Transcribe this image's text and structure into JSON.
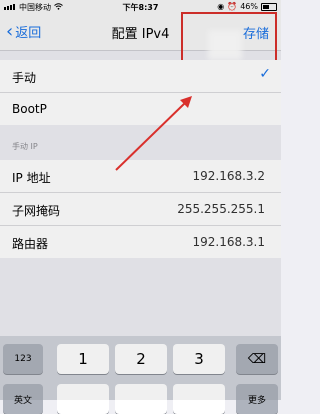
{
  "statusbar": {
    "carrier": "中国移动",
    "time": "下午8:37",
    "battery": "46%",
    "battery_level": 0.46
  },
  "navbar": {
    "back_label": "返回",
    "title": "配置 IPv4",
    "save_label": "存储"
  },
  "mode_options": [
    {
      "label": "手动",
      "checked": true
    },
    {
      "label": "BootP",
      "checked": false
    }
  ],
  "manual_section": {
    "header": "手动 IP",
    "fields": [
      {
        "label": "IP 地址",
        "value": "192.168.3.2"
      },
      {
        "label": "子网掩码",
        "value": "255.255.255.1"
      },
      {
        "label": "路由器",
        "value": "192.168.3.1"
      }
    ]
  },
  "keyboard": {
    "row1": [
      "123",
      "1",
      "2",
      "3",
      "⌫"
    ],
    "row2": [
      "英文",
      "更多"
    ]
  },
  "colors": {
    "accent": "#1a73e8",
    "annotation": "#d9302c"
  }
}
